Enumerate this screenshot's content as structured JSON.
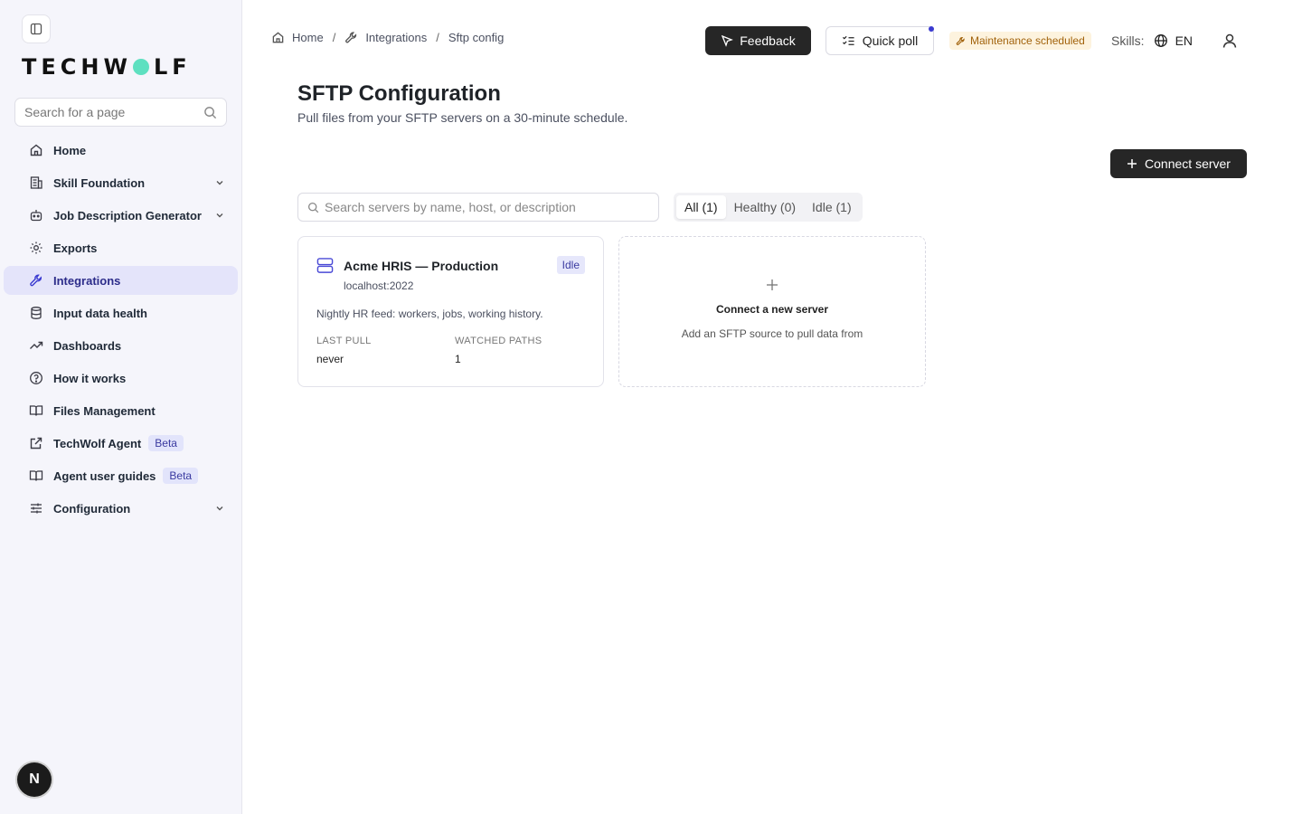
{
  "sidebar": {
    "search_placeholder": "Search for a page",
    "logo_left": "TECHW",
    "logo_right": "LF",
    "items": [
      {
        "label": "Home"
      },
      {
        "label": "Skill Foundation"
      },
      {
        "label": "Job Description Generator"
      },
      {
        "label": "Exports"
      },
      {
        "label": "Integrations"
      },
      {
        "label": "Input data health"
      },
      {
        "label": "Dashboards"
      },
      {
        "label": "How it works"
      },
      {
        "label": "Files Management"
      },
      {
        "label": "TechWolf Agent",
        "badge": "Beta"
      },
      {
        "label": "Agent user guides",
        "badge": "Beta"
      },
      {
        "label": "Configuration"
      }
    ],
    "avatar_initial": "N"
  },
  "breadcrumb": {
    "home": "Home",
    "integrations": "Integrations",
    "current": "Sftp config",
    "separator": "/"
  },
  "header": {
    "feedback_label": "Feedback",
    "poll_label": "Quick poll",
    "maintenance_label": "Maintenance scheduled",
    "skills_label": "Skills:",
    "language": "EN"
  },
  "main": {
    "title": "SFTP Configuration",
    "subtitle": "Pull files from your SFTP servers on a 30-minute schedule.",
    "connect_button": "Connect server",
    "search_placeholder": "Search servers by name, host, or description",
    "filters": [
      {
        "label": "All (1)",
        "active": true
      },
      {
        "label": "Healthy (0)",
        "active": false
      },
      {
        "label": "Idle (1)",
        "active": false
      }
    ],
    "servers": [
      {
        "name": "Acme HRIS — Production",
        "host": "localhost:2022",
        "status": "Idle",
        "description": "Nightly HR feed: workers, jobs, working history.",
        "last_pull_label": "LAST PULL",
        "last_pull_value": "never",
        "watched_paths_label": "WATCHED PATHS",
        "watched_paths_value": "1"
      }
    ],
    "new_server": {
      "title": "Connect a new server",
      "subtitle": "Add an SFTP source to pull data from"
    }
  },
  "colors": {
    "accent": "#3a3ad0",
    "active_nav_bg": "#e4e4fa",
    "primary_button": "#262626",
    "logo_dot": "#5ee0c0",
    "maintenance_bg": "#fdf3de",
    "maintenance_text": "#a1620b"
  }
}
